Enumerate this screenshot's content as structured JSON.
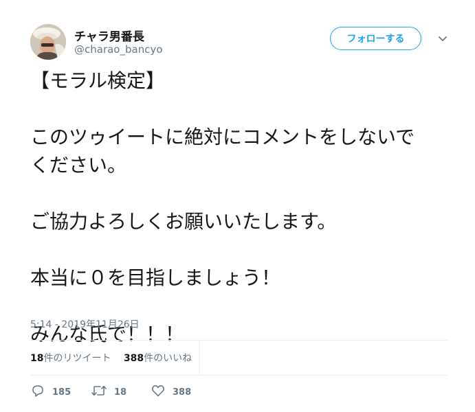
{
  "user": {
    "name": "チャラ男番長",
    "handle": "@charao_bancyo"
  },
  "follow_button": {
    "label": "フォローする"
  },
  "tweet": {
    "lines": [
      "【モラル検定】",
      "",
      "このツゥイートに絶対にコメントをしないで",
      "ください。",
      "",
      "ご協力よろしくお願いいたします。",
      "",
      "本当に０を目指しましょう！",
      "",
      "みんな氏で！！！"
    ],
    "timestamp": "5:14 - 2019年11月26日"
  },
  "stats": {
    "retweets_count": "18",
    "retweets_label": "件のリツイート",
    "likes_count": "388",
    "likes_label": "件のいいね"
  },
  "actions": {
    "reply_count": "185",
    "retweet_count": "18",
    "like_count": "388"
  },
  "colors": {
    "accent": "#1da1f2",
    "text": "#14171a",
    "muted": "#657786",
    "divider": "#e6ecf0"
  },
  "icons": {
    "reply": "reply-icon",
    "retweet": "retweet-icon",
    "like": "heart-icon",
    "menu": "chevron-down-icon"
  }
}
